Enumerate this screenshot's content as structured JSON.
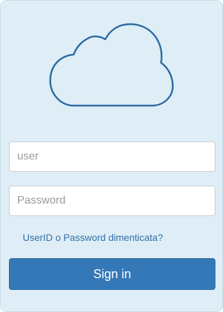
{
  "logo": {
    "icon": "cloud-icon",
    "stroke_color": "#2a6aa3"
  },
  "login": {
    "user_placeholder": "user",
    "password_placeholder": "Password",
    "forgot_link": "UserID o Password dimenticata?",
    "signin_label": "Sign in"
  },
  "colors": {
    "background": "#dfedf6",
    "accent": "#3478b7",
    "link": "#2f6fa8"
  }
}
